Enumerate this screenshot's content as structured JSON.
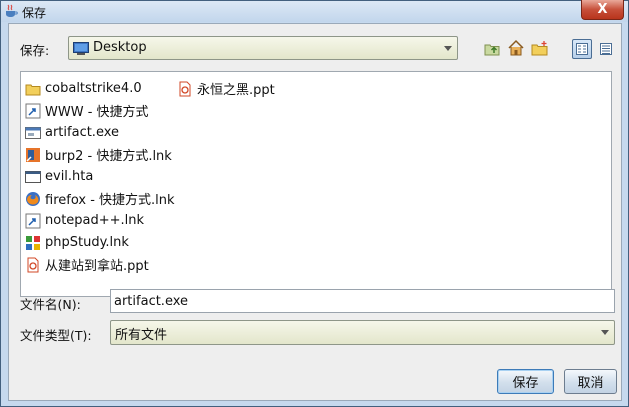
{
  "window": {
    "title": "保存",
    "close_label": "X"
  },
  "save_in": {
    "label": "保存:",
    "value": "Desktop"
  },
  "toolbar": {
    "up_icon": "folder-up-icon",
    "home_icon": "home-icon",
    "new_folder_icon": "new-folder-icon",
    "list_view_icon": "list-view-icon",
    "details_view_icon": "details-view-icon"
  },
  "files": [
    {
      "name": "cobaltstrike4.0",
      "icon": "folder-icon"
    },
    {
      "name": "WWW - 快捷方式",
      "icon": "shortcut-icon"
    },
    {
      "name": "artifact.exe",
      "icon": "exe-icon"
    },
    {
      "name": "burp2 - 快捷方式.lnk",
      "icon": "burp-shortcut-icon"
    },
    {
      "name": "evil.hta",
      "icon": "hta-icon"
    },
    {
      "name": "firefox - 快捷方式.lnk",
      "icon": "firefox-shortcut-icon"
    },
    {
      "name": "notepad++.lnk",
      "icon": "notepad-shortcut-icon"
    },
    {
      "name": "phpStudy.lnk",
      "icon": "phpstudy-shortcut-icon"
    },
    {
      "name": "从建站到拿站.ppt",
      "icon": "ppt-icon"
    },
    {
      "name": "永恒之黑.ppt",
      "icon": "ppt-icon"
    }
  ],
  "filename": {
    "label": "文件名(N):",
    "value": "artifact.exe"
  },
  "filetype": {
    "label": "文件类型(T):",
    "value": "所有文件"
  },
  "buttons": {
    "save": "保存",
    "cancel": "取消"
  }
}
